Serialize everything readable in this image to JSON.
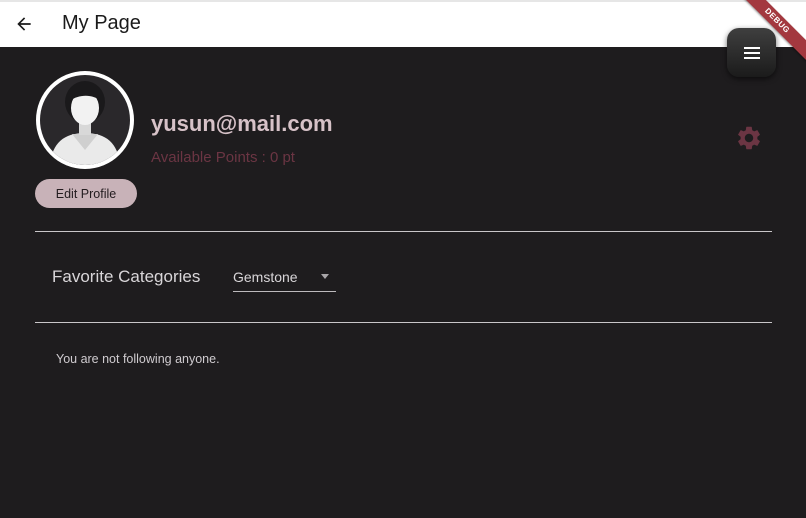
{
  "appbar": {
    "title": "My Page",
    "back_icon": "arrow-left-icon",
    "debug_label": "DEBUG"
  },
  "fab": {
    "icon": "hamburger-menu-icon"
  },
  "profile": {
    "email": "yusun@mail.com",
    "points_text": "Available Points : 0 pt",
    "edit_button_label": "Edit Profile",
    "avatar_icon": "user-avatar-icon",
    "settings_icon": "gear-icon",
    "settings_color": "#6b3543"
  },
  "favorites": {
    "label": "Favorite Categories",
    "selected": "Gemstone"
  },
  "following": {
    "empty_message": "You are not following anyone."
  },
  "colors": {
    "background": "#1e1c1e",
    "appbar": "#ffffff",
    "accent_button": "#c8b2b8",
    "points_text": "#6b3543",
    "debug_banner": "#a3383f"
  }
}
